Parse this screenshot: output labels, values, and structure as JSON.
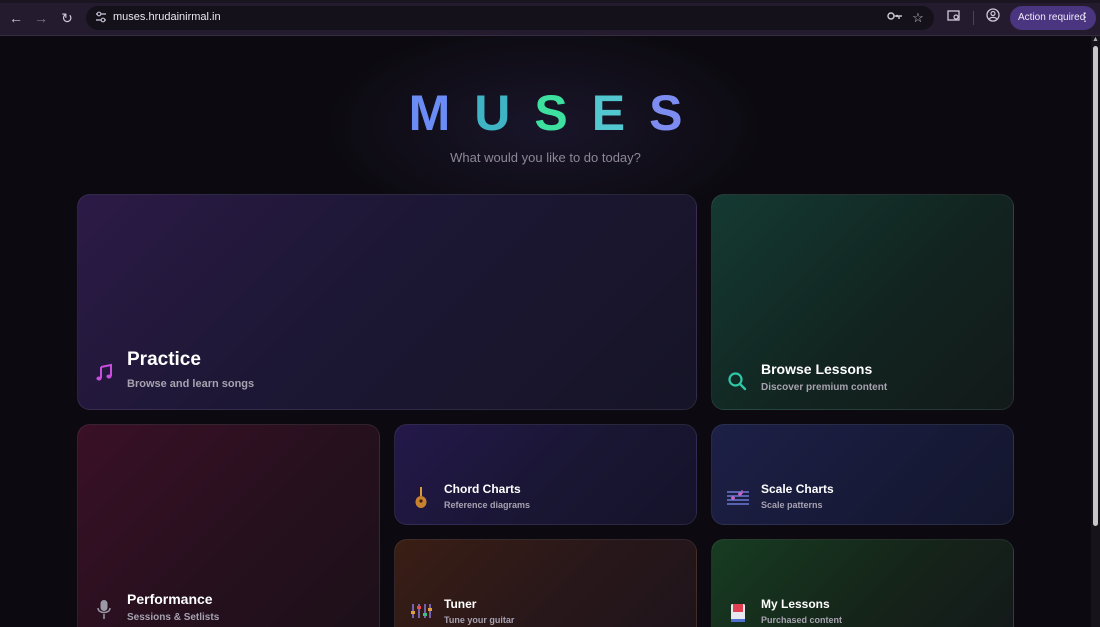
{
  "browser": {
    "url": "muses.hrudainirmal.in",
    "action_label": "Action required",
    "icons": {
      "back": "arrow-left-icon",
      "forward": "arrow-right-icon",
      "reload": "reload-icon",
      "site_settings": "tune-icon",
      "passwords": "key-icon",
      "bookmark": "star-icon",
      "tab_search": "tab-search-icon",
      "profile": "profile-icon",
      "menu": "kebab-menu-icon"
    }
  },
  "header": {
    "logo_letters": [
      "M",
      "U",
      "S",
      "E",
      "S"
    ],
    "logo_colors": [
      "#6b8cf5",
      "#3fb4c4",
      "#3ee0a0",
      "#52c7cf",
      "#7d8cf0"
    ],
    "subtitle": "What would you like to do today?"
  },
  "cards": {
    "practice": {
      "title": "Practice",
      "description": "Browse and learn songs",
      "icon": "music-note-icon",
      "icon_color": "#c84ee0"
    },
    "browse": {
      "title": "Browse Lessons",
      "description": "Discover premium content",
      "icon": "search-icon",
      "icon_color": "#2fc7a6"
    },
    "performance": {
      "title": "Performance",
      "description": "Sessions & Setlists",
      "icon": "microphone-icon",
      "icon_color": "#9a9aa6"
    },
    "chord": {
      "title": "Chord Charts",
      "description": "Reference diagrams",
      "icon": "guitar-icon",
      "icon_color": "#d89a3a"
    },
    "scale": {
      "title": "Scale Charts",
      "description": "Scale patterns",
      "icon": "staff-notes-icon",
      "icon_color": "#7a8cf0"
    },
    "tuner": {
      "title": "Tuner",
      "description": "Tune your guitar",
      "icon": "level-sliders-icon",
      "icon_color": "#e0a040"
    },
    "mylessons": {
      "title": "My Lessons",
      "description": "Purchased content",
      "icon": "book-icon",
      "icon_color": "#e04050"
    }
  }
}
